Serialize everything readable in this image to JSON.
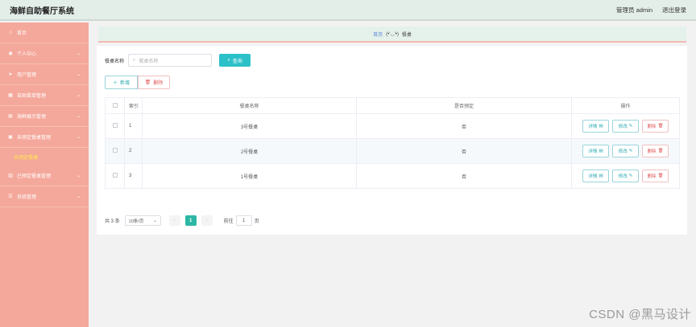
{
  "header": {
    "app_title": "海鲜自助餐厅系统",
    "user_label": "管理员 admin",
    "logout_label": "退出登录"
  },
  "sidebar": {
    "items": [
      {
        "label": "首页",
        "icon": "home-icon",
        "glyph": "⌂",
        "has_chevron": false
      },
      {
        "label": "个人中心",
        "icon": "user-icon",
        "glyph": "◉",
        "has_chevron": true
      },
      {
        "label": "用户管理",
        "icon": "send-icon",
        "glyph": "➤",
        "has_chevron": true
      },
      {
        "label": "自助菜单管理",
        "icon": "grid-icon",
        "glyph": "▦",
        "has_chevron": true
      },
      {
        "label": "海鲜展示管理",
        "icon": "chart-icon",
        "glyph": "▤",
        "has_chevron": true
      },
      {
        "label": "未预定餐桌管理",
        "icon": "list-icon",
        "glyph": "▣",
        "has_chevron": true
      },
      {
        "label": "未预定餐桌",
        "icon": "",
        "glyph": "",
        "has_chevron": false,
        "sub": true
      },
      {
        "label": "已预定餐桌管理",
        "icon": "table-icon",
        "glyph": "▥",
        "has_chevron": true
      },
      {
        "label": "系统管理",
        "icon": "settings-icon",
        "glyph": "☰",
        "has_chevron": true
      }
    ],
    "bg_color": "#f4a89b",
    "active_sub_color": "#ffe74a"
  },
  "breadcrumb": {
    "home": "首页",
    "separator": "(•'◡'•)",
    "current": "餐桌"
  },
  "search": {
    "label": "餐桌名称",
    "placeholder": "餐桌名称",
    "button": "查询"
  },
  "actions": {
    "add": "新增",
    "delete": "删除"
  },
  "table": {
    "columns": [
      "",
      "索引",
      "餐桌名称",
      "是否预定",
      "操作"
    ],
    "rows": [
      {
        "index": "1",
        "name": "3号餐桌",
        "reserved": "否"
      },
      {
        "index": "2",
        "name": "2号餐桌",
        "reserved": "否"
      },
      {
        "index": "3",
        "name": "1号餐桌",
        "reserved": "否"
      }
    ],
    "op_detail": "详情",
    "op_edit": "修改",
    "op_delete": "删除"
  },
  "pager": {
    "total": "共 3 条",
    "page_size": "10条/页",
    "current_page": "1",
    "goto_label": "前往",
    "goto_value": "1",
    "page_unit": "页"
  },
  "watermark": "CSDN @黑马设计",
  "colors": {
    "accent": "#2cc1c9",
    "danger": "#e15858",
    "page_active": "#2cb7a5"
  }
}
